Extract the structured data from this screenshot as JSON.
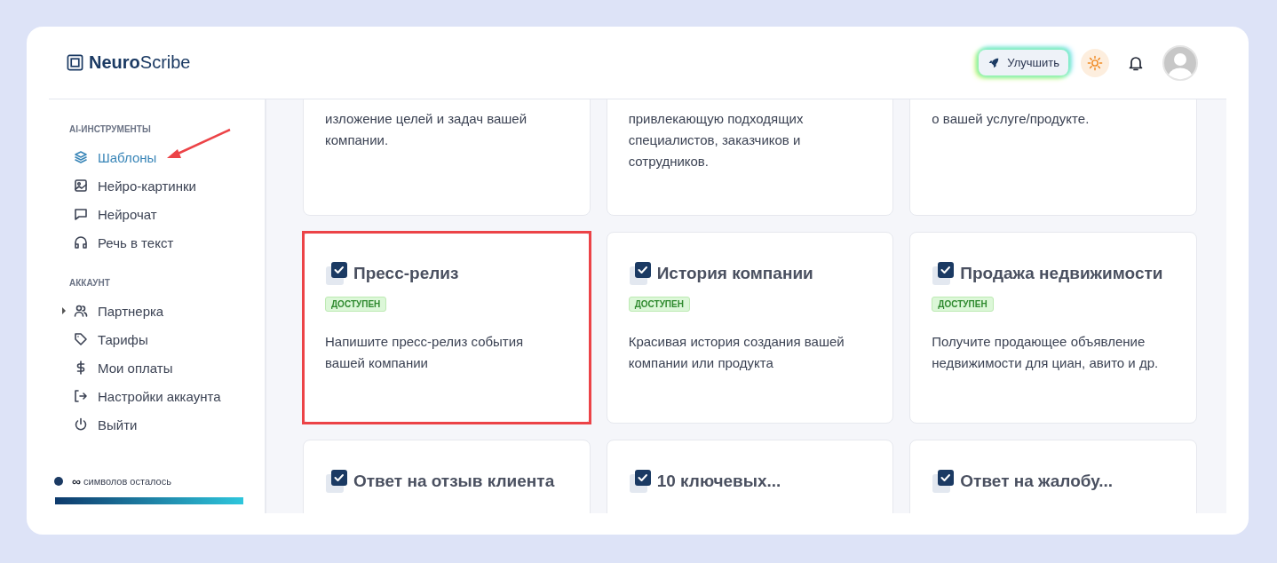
{
  "header": {
    "logo": "**Neuro**Scribe",
    "upgrade_button": "Улучшить"
  },
  "sidebar": {
    "sections": [
      {
        "title": "AI-ИНСТРУМЕНТЫ",
        "items": [
          {
            "label": "Шаблоны",
            "kind": "layers",
            "selected": true
          },
          {
            "label": "Нейро-картинки",
            "kind": "image",
            "selected": false
          },
          {
            "label": "Нейрочат",
            "kind": "chat",
            "selected": false
          },
          {
            "label": "Речь в текст",
            "kind": "headphones",
            "selected": false
          }
        ]
      },
      {
        "title": "АККАУНТ",
        "items": [
          {
            "label": "Партнерка",
            "kind": "users",
            "selected": false,
            "expanded": false
          },
          {
            "label": "Тарифы",
            "kind": "tag",
            "selected": false
          },
          {
            "label": "Мои оплаты",
            "kind": "dollar",
            "selected": false
          },
          {
            "label": "Настройки аккаунта",
            "kind": "login",
            "selected": false
          },
          {
            "label": "Выйти",
            "kind": "power",
            "selected": false
          }
        ]
      }
    ],
    "usage": {
      "amount": "∞",
      "label": "символов осталось",
      "level": 1
    }
  },
  "cards": [
    {
      "lines": [
        "изложение целей и задач вашей",
        "компании."
      ]
    },
    {
      "lines": [
        "привлекающую подходящих",
        "специалистов, заказчиков и",
        "сотрудников."
      ]
    },
    {
      "lines": [
        "о вашей услуге/продукте."
      ]
    },
    {
      "title": "Пресс-релиз",
      "badge": "ДОСТУПЕН",
      "lines": [
        "Напишите пресс-релиз события",
        "вашей компании"
      ],
      "highlighted": true
    },
    {
      "title": "История компании",
      "badge": "ДОСТУПЕН",
      "lines": [
        "Красивая история создания вашей",
        "компании или продукта"
      ],
      "highlighted": false
    },
    {
      "title": "Продажа недвижимости",
      "badge": "ДОСТУПЕН",
      "lines": [
        "Получите продающее объявление",
        "недвижимости для циан, авито и др."
      ],
      "highlighted": false
    },
    {
      "title": "Ответ на отзыв клиента",
      "highlighted": false
    },
    {
      "title": "10 ключевых...",
      "highlighted": false
    },
    {
      "title": "Ответ на жалобу...",
      "highlighted": false
    }
  ]
}
